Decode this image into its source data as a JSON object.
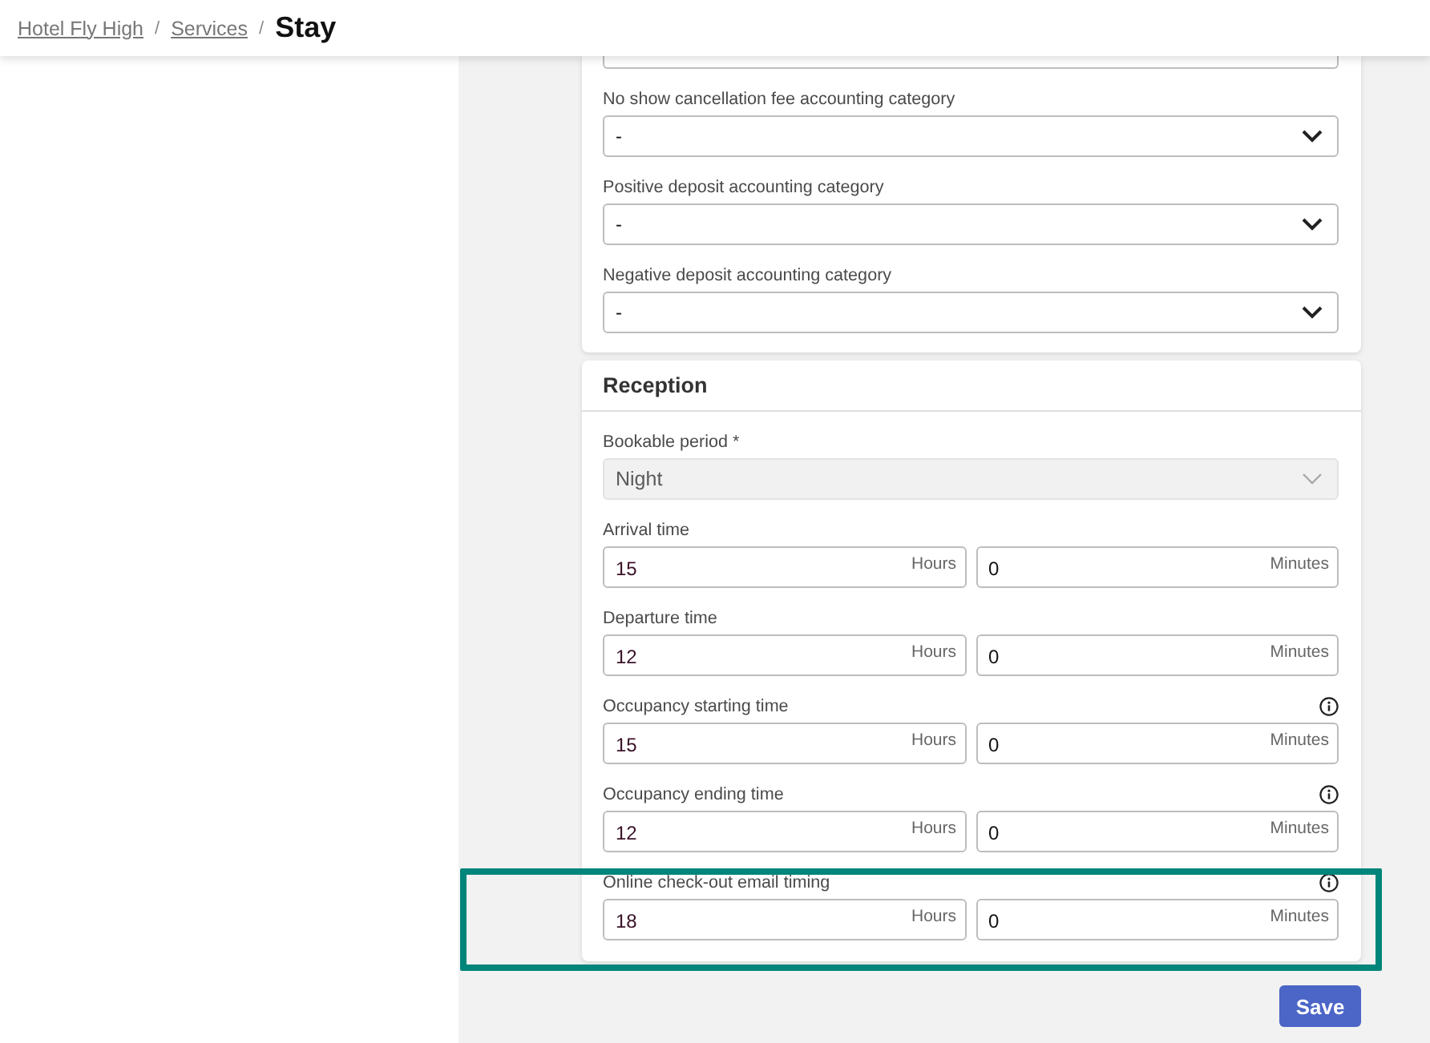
{
  "breadcrumb": [
    {
      "kind": "link",
      "label": "Hotel Fly High"
    },
    {
      "kind": "separator",
      "label": "/"
    },
    {
      "kind": "link",
      "label": "Services"
    },
    {
      "kind": "separator",
      "label": "/"
    },
    {
      "kind": "current",
      "label": "Stay"
    }
  ],
  "accounting": {
    "fields": [
      {
        "label": "No show cancellation fee accounting category",
        "value": "-",
        "disabled": false
      },
      {
        "label": "Positive deposit accounting category",
        "value": "-",
        "disabled": false
      },
      {
        "label": "Negative deposit accounting category",
        "value": "-",
        "disabled": false
      }
    ]
  },
  "reception": {
    "title": "Reception",
    "period": {
      "label": "Bookable period *",
      "value": "Night",
      "disabled": true
    },
    "times": [
      {
        "label": "Arrival time",
        "info": false,
        "highlighted": false,
        "hours": {
          "value": "15",
          "unit": "Hours"
        },
        "minutes": {
          "value": "0",
          "unit": "Minutes"
        }
      },
      {
        "label": "Departure time",
        "info": false,
        "highlighted": false,
        "hours": {
          "value": "12",
          "unit": "Hours"
        },
        "minutes": {
          "value": "0",
          "unit": "Minutes"
        }
      },
      {
        "label": "Occupancy starting time",
        "info": true,
        "highlighted": false,
        "hours": {
          "value": "15",
          "unit": "Hours"
        },
        "minutes": {
          "value": "0",
          "unit": "Minutes"
        }
      },
      {
        "label": "Occupancy ending time",
        "info": true,
        "highlighted": false,
        "hours": {
          "value": "12",
          "unit": "Hours"
        },
        "minutes": {
          "value": "0",
          "unit": "Minutes"
        }
      },
      {
        "label": "Online check-out email timing",
        "info": true,
        "highlighted": true,
        "hours": {
          "value": "18",
          "unit": "Hours"
        },
        "minutes": {
          "value": "0",
          "unit": "Minutes"
        }
      }
    ]
  },
  "save_button": {
    "label": "Save"
  }
}
